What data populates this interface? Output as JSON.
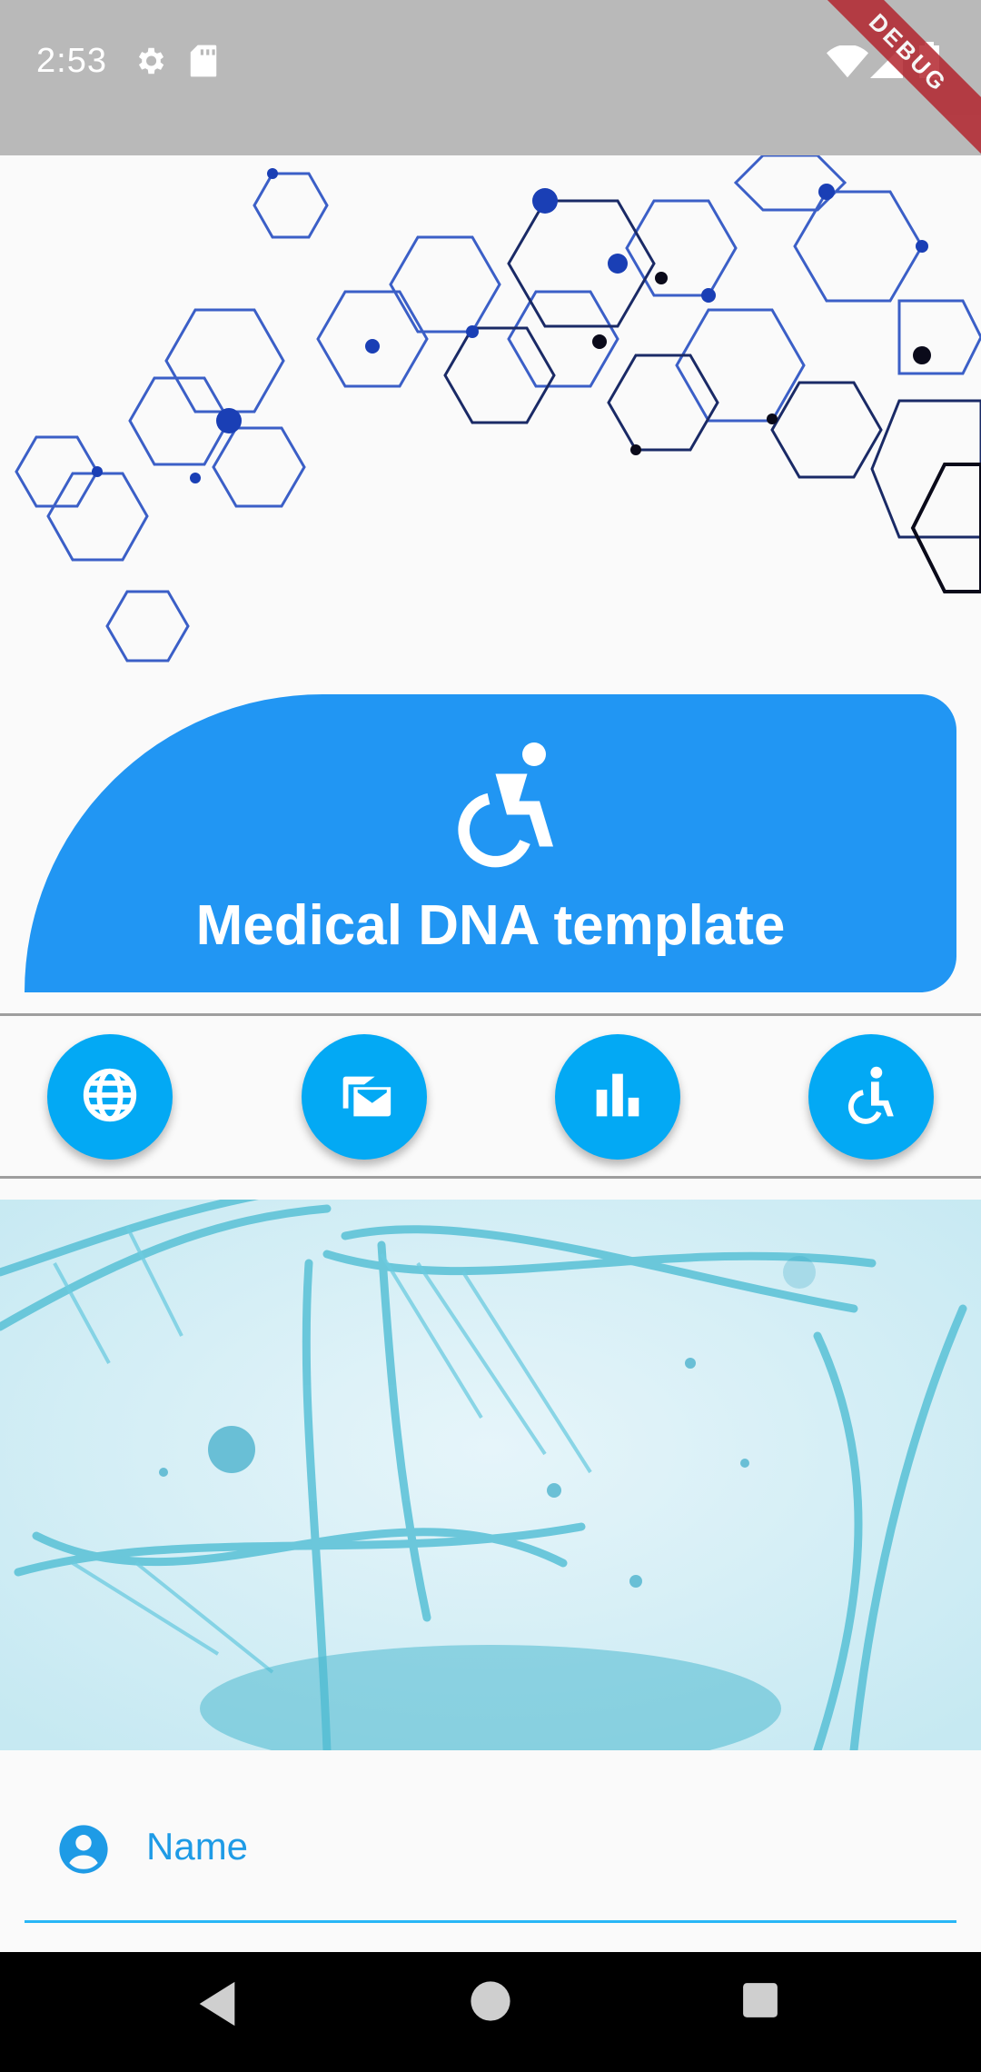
{
  "status_bar": {
    "time": "2:53",
    "icons": [
      "gear-icon",
      "sd-card-icon",
      "wifi-icon",
      "signal-icon",
      "battery-icon"
    ],
    "debug_label": "DEBUG"
  },
  "header": {
    "title": "Medical DNA template",
    "icon": "wheelchair-icon",
    "color": "#2196f3"
  },
  "actions": [
    {
      "icon": "globe-icon"
    },
    {
      "icon": "mail-icon"
    },
    {
      "icon": "bar-chart-icon"
    },
    {
      "icon": "accessible-icon"
    }
  ],
  "form": {
    "name_label": "Name",
    "name_icon": "account-circle-icon"
  },
  "nav": [
    "back-icon",
    "home-icon",
    "recents-icon"
  ],
  "colors": {
    "accent": "#03a9f4",
    "header": "#2196f3",
    "status_bar": "#b9b9b9"
  }
}
